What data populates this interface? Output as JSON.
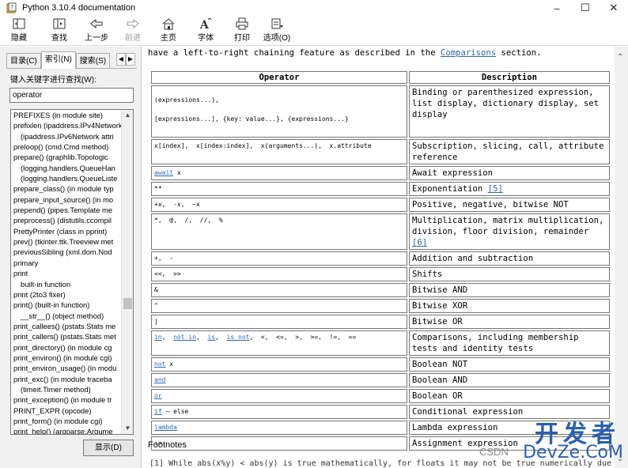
{
  "window": {
    "title": "Python 3.10.4 documentation"
  },
  "toolbar": {
    "buttons": [
      {
        "label": "隐藏",
        "icon": "hide-icon",
        "enabled": true
      },
      {
        "label": "查找",
        "icon": "locate-icon",
        "enabled": true
      },
      {
        "label": "上一步",
        "icon": "back-arrow-icon",
        "enabled": true
      },
      {
        "label": "前进",
        "icon": "forward-arrow-icon",
        "enabled": false
      },
      {
        "label": "主页",
        "icon": "home-icon",
        "enabled": true
      },
      {
        "label": "字体",
        "icon": "font-icon",
        "enabled": true
      },
      {
        "label": "打印",
        "icon": "print-icon",
        "enabled": true
      },
      {
        "label": "选项(O)",
        "icon": "options-icon",
        "enabled": true
      }
    ]
  },
  "leftpane": {
    "tabs": [
      "目录(C)",
      "索引(N)",
      "搜索(S)"
    ],
    "active_tab": "索引(N)",
    "keyword_label": "键入关键字进行查找(W):",
    "search_value": "operator",
    "index_items": [
      {
        "text": "PREFIXES (in module site)",
        "sub": false
      },
      {
        "text": "prefixlen (ipaddress.IPv4Network",
        "sub": false
      },
      {
        "text": "(ipaddress.IPv6Network attri",
        "sub": true
      },
      {
        "text": "preloop() (cmd.Cmd method)",
        "sub": false
      },
      {
        "text": "prepare() (graphlib.Topologic",
        "sub": false
      },
      {
        "text": "(logging.handlers.QueueHan",
        "sub": true
      },
      {
        "text": "(logging.handlers.QueueListe",
        "sub": true
      },
      {
        "text": "prepare_class() (in module typ",
        "sub": false
      },
      {
        "text": "prepare_input_source() (in mo",
        "sub": false
      },
      {
        "text": "prepend() (pipes.Template me",
        "sub": false
      },
      {
        "text": "preprocess() (distutils.ccompil",
        "sub": false
      },
      {
        "text": "PrettyPrinter (class in pprint)",
        "sub": false
      },
      {
        "text": "prev() (tkinter.ttk.Treeview met",
        "sub": false
      },
      {
        "text": "previousSibling (xml.dom.Nod",
        "sub": false
      },
      {
        "text": "primary",
        "sub": false
      },
      {
        "text": "print",
        "sub": false
      },
      {
        "text": "built-in function",
        "sub": true
      },
      {
        "text": "print (2to3 fixer)",
        "sub": false
      },
      {
        "text": "print() (built-in function)",
        "sub": false
      },
      {
        "text": "__str__() (object method)",
        "sub": true
      },
      {
        "text": "print_callees() (pstats.Stats me",
        "sub": false
      },
      {
        "text": "print_callers() (pstats.Stats met",
        "sub": false
      },
      {
        "text": "print_directory() (in module cg",
        "sub": false
      },
      {
        "text": "print_environ() (in module cgi)",
        "sub": false
      },
      {
        "text": "print_environ_usage() (in modu",
        "sub": false
      },
      {
        "text": "print_exc() (in module traceba",
        "sub": false
      },
      {
        "text": "(timeit.Timer method)",
        "sub": true
      },
      {
        "text": "print_exception() (in module tr",
        "sub": false
      },
      {
        "text": "PRINT_EXPR (opcode)",
        "sub": false
      },
      {
        "text": "print_form() (in module cgi)",
        "sub": false
      },
      {
        "text": "print_help() (argparse.Argume",
        "sub": false
      }
    ],
    "show_button": "显示(D)"
  },
  "content": {
    "intro_prefix": "have a left-to-right chaining feature as described in the ",
    "intro_link": "Comparisons",
    "intro_suffix": " section.",
    "table_headers": [
      "Operator",
      "Description"
    ],
    "rows": [
      {
        "op_parts": [
          {
            "t": "(expressions...),"
          },
          {
            "t": "\n\n[expressions...],  {key: value...},  {expressions...}"
          }
        ],
        "desc": "Binding or parenthesized expression, list display, dictionary display, set display",
        "h": 66
      },
      {
        "op_parts": [
          {
            "t": "x[index],  x[index:index],  x(arguments...),  x.attribute"
          }
        ],
        "desc": "Subscription, slicing, call, attribute reference",
        "h": 32
      },
      {
        "op_parts": [
          {
            "t": "await",
            "link": true
          },
          {
            "t": " x"
          }
        ],
        "desc": "Await expression",
        "h": 16
      },
      {
        "op_parts": [
          {
            "t": "**"
          }
        ],
        "desc": "Exponentiation",
        "fn": "[5]",
        "h": 16
      },
      {
        "op_parts": [
          {
            "t": "+x,  -x,  ~x"
          }
        ],
        "desc": "Positive, negative, bitwise NOT",
        "h": 16
      },
      {
        "op_parts": [
          {
            "t": "*,  @,  /,  //,  %"
          }
        ],
        "desc": "Multiplication, matrix multiplication, division, floor division, remainder",
        "fn": "[6]",
        "h": 32
      },
      {
        "op_parts": [
          {
            "t": "+,  -"
          }
        ],
        "desc": "Addition and subtraction",
        "h": 16
      },
      {
        "op_parts": [
          {
            "t": "<<,  >>"
          }
        ],
        "desc": "Shifts",
        "h": 16
      },
      {
        "op_parts": [
          {
            "t": "&"
          }
        ],
        "desc": "Bitwise AND",
        "h": 16
      },
      {
        "op_parts": [
          {
            "t": "^"
          }
        ],
        "desc": "Bitwise XOR",
        "h": 16
      },
      {
        "op_parts": [
          {
            "t": "|"
          }
        ],
        "desc": "Bitwise OR",
        "h": 16
      },
      {
        "op_parts": [
          {
            "t": "in",
            "link": true
          },
          {
            "t": ",  "
          },
          {
            "t": "not in",
            "link": true
          },
          {
            "t": ",  "
          },
          {
            "t": "is",
            "link": true
          },
          {
            "t": ",  "
          },
          {
            "t": "is not",
            "link": true
          },
          {
            "t": ",  <,  <=,  >,  >=,  !=,  =="
          }
        ],
        "desc": "Comparisons, including membership tests and identity tests",
        "h": 32
      },
      {
        "op_parts": [
          {
            "t": "not",
            "link": true
          },
          {
            "t": " x"
          }
        ],
        "desc": "Boolean NOT",
        "h": 16
      },
      {
        "op_parts": [
          {
            "t": "and",
            "link": true
          }
        ],
        "desc": "Boolean AND",
        "h": 16
      },
      {
        "op_parts": [
          {
            "t": "or",
            "link": true
          }
        ],
        "desc": "Boolean OR",
        "h": 16
      },
      {
        "op_parts": [
          {
            "t": "if",
            "link": true
          },
          {
            "t": " – else"
          }
        ],
        "desc": "Conditional expression",
        "h": 16
      },
      {
        "op_parts": [
          {
            "t": "lambda",
            "link": true
          }
        ],
        "desc": "Lambda expression",
        "h": 16
      },
      {
        "op_parts": [
          {
            "t": ":="
          }
        ],
        "desc": "Assignment expression",
        "h": 16
      }
    ],
    "footnotes_title": "Footnotes",
    "footnote_line": "[1] While abs(x%y) < abs(y) is true mathematically, for floats it may not be true numerically due"
  },
  "watermark": {
    "big": "开发者",
    "small": "DevZe.CoM",
    "csdn": "CSDN"
  },
  "colors": {
    "link": "#2f66b0",
    "watermark": "#2a5fb0"
  }
}
